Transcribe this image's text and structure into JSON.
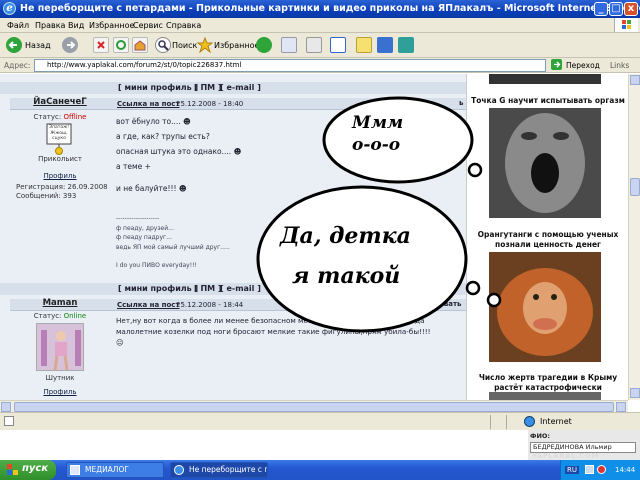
{
  "window": {
    "title": "Не переборщите с петардами - Прикольные картинки и видео приколы на ЯПлакалъ - Microsoft Internet Explorer",
    "controls": [
      "_",
      "□",
      "x"
    ]
  },
  "menu": [
    "Файл",
    "Правка",
    "Вид",
    "Избранное",
    "Сервис",
    "Справка"
  ],
  "toolbar": {
    "back": "Назад",
    "search": "Поиск",
    "favorites": "Избранное"
  },
  "address": {
    "label": "Адрес:",
    "url": "http://www.yaplakal.com/forum2/st/0/topic226837.html",
    "go": "Переход",
    "links": "Links"
  },
  "profile_links": [
    "[ мини профиль ]",
    "[ ПМ ]",
    "[ e-mail ]"
  ],
  "posts": [
    {
      "username": "ЙаСанечеГ",
      "status_label": "Статус:",
      "status": "Offline",
      "status_color": "#cc0000",
      "rank": "Прикольист",
      "avatar_text": [
        "Эпатаж!",
        "Жжош,",
        "сцуко"
      ],
      "profile": "Профиль",
      "registered": "Регистрация: 26.09.2008",
      "messages": "Сообщений: 393",
      "post_link": "Ссылка на пост",
      "date": "25.12.2008 - 18:40",
      "lines": [
        "вот ёбнуло то....",
        "а где, как? трупы есть?",
        "опасная штука это однако....",
        "а теме +",
        "",
        "и не балуйте!!!"
      ],
      "signature": [
        "--------------------",
        "ф пеаду, друзей...",
        "ф пеаду падруг...",
        "ведь ЯП мой самый лучший друг.....",
        "",
        "I do you ПИВО everyday!!!"
      ]
    },
    {
      "username": "Maman",
      "status_label": "Статус:",
      "status": "Online",
      "status_color": "#118811",
      "rank": "Шутник",
      "profile": "Профиль",
      "post_link": "Ссылка на пост",
      "date": "25.12.2008 - 18:44",
      "lines": [
        "Нет,ну вот когда в более ли менее безопасном месте это еще ладно,а вот когда",
        "малолетние козелки под ноги бросают мелкие такие фигулины,прям убила-бы!!!!"
      ]
    }
  ],
  "cut_labels": {
    "reply_right": "ь",
    "quote_right": "ровать"
  },
  "sidebar": {
    "captions": [
      "Точка G научит испытывать оргазм",
      "Орангутанги с помощью ученых познали ценность денег",
      "Число жертв трагедии в Крыму растёт катастрофически"
    ]
  },
  "bubbles": {
    "top": [
      "Ммм",
      "о-о-о"
    ],
    "bottom": [
      "Да, детка",
      "я такой"
    ]
  },
  "status_bar": {
    "zone": "Internet"
  },
  "fio": {
    "label": "ФИО:",
    "value": "БЕДРЕДИНОВА Ильмир"
  },
  "watermark": "YAPLAKAL.COM",
  "taskbar": {
    "start": "пуск",
    "tasks": [
      "МЕДИАЛОГ",
      "Не переборщите с п..."
    ],
    "lang": "RU",
    "clock": "14:44"
  },
  "colors": {
    "title_bar": "#0b3fb8",
    "chrome": "#ece9d8",
    "forum_bg": "#eaeef5",
    "header_bg": "#d7dfeb"
  }
}
